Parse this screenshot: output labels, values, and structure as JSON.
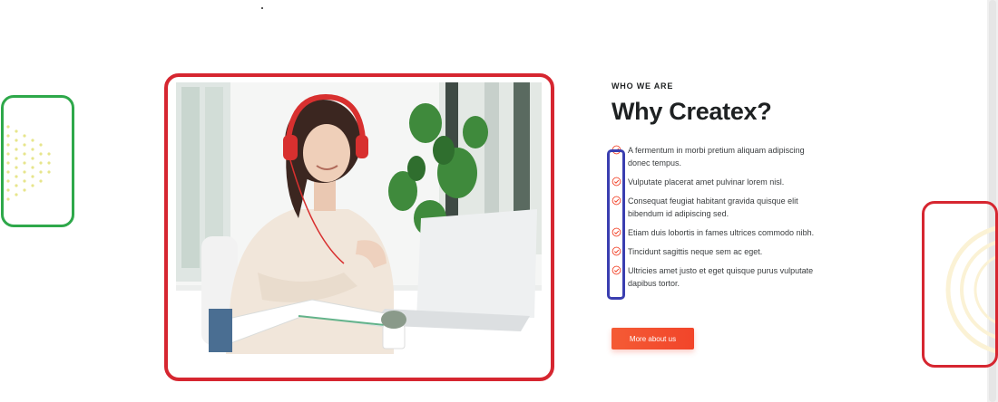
{
  "section": {
    "eyebrow": "WHO WE ARE",
    "title": "Why Createx?",
    "features": [
      "A fermentum in morbi pretium aliquam adipiscing donec tempus.",
      "Vulputate placerat amet pulvinar lorem nisl.",
      "Consequat feugiat habitant gravida quisque elit bibendum id adipiscing sed.",
      "Etiam duis lobortis in fames ultrices commodo nibh.",
      "Tincidunt sagittis neque sem ac eget.",
      "Ultricies amet justo et eget quisque purus vulputate dapibus tortor."
    ],
    "cta_label": "More about us"
  },
  "icons": {
    "feature": "check-circle-icon",
    "decor_left": "dot-triangle-pattern",
    "decor_right": "concentric-rings"
  },
  "colors": {
    "accent": "#f2452a",
    "heading": "#1e2122",
    "check": "#f2452a",
    "highlight_green": "#2ea84a",
    "highlight_red": "#d62630",
    "highlight_blue": "#3a3eb0"
  }
}
